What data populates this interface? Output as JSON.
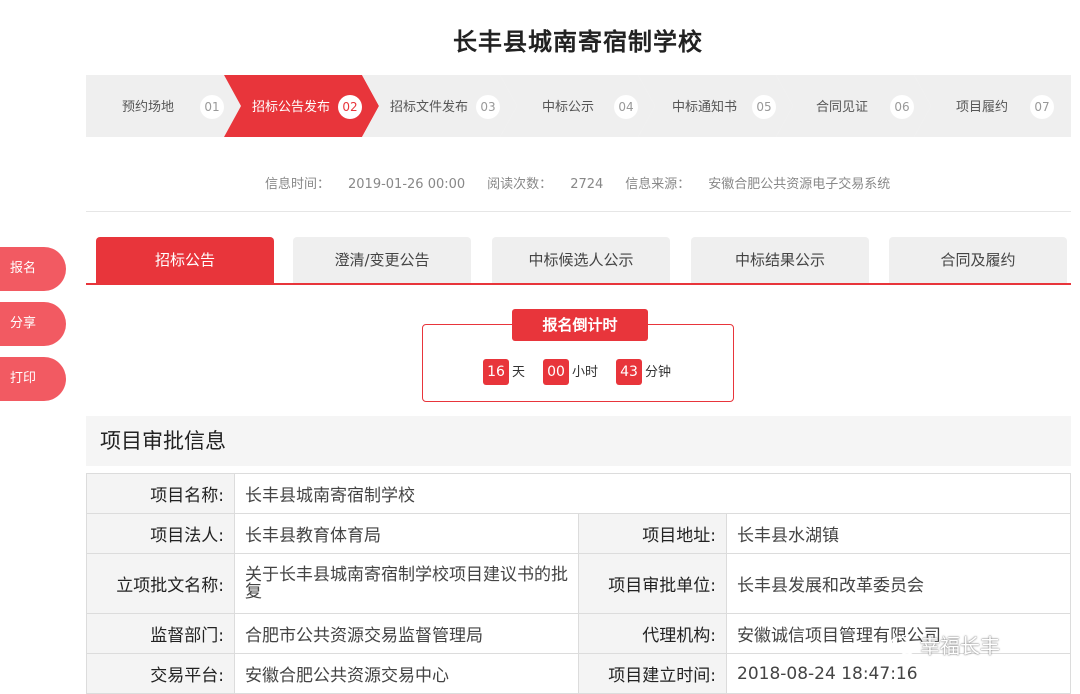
{
  "page_title": "长丰县城南寄宿制学校",
  "steps": [
    {
      "label": "预约场地",
      "num": "01"
    },
    {
      "label": "招标公告发布",
      "num": "02"
    },
    {
      "label": "招标文件发布",
      "num": "03"
    },
    {
      "label": "中标公示",
      "num": "04"
    },
    {
      "label": "中标通知书",
      "num": "05"
    },
    {
      "label": "合同见证",
      "num": "06"
    },
    {
      "label": "项目履约",
      "num": "07"
    }
  ],
  "info": {
    "time_label": "信息时间：",
    "time_value": "2019-01-26 00:00",
    "reads_label": "阅读次数：",
    "reads_value": "2724",
    "source_label": "信息来源：",
    "source_value": "安徽合肥公共资源电子交易系统"
  },
  "side_buttons": [
    "报名",
    "分享",
    "打印"
  ],
  "tabs": [
    "招标公告",
    "澄清/变更公告",
    "中标候选人公示",
    "中标结果公示",
    "合同及履约"
  ],
  "countdown": {
    "title": "报名倒计时",
    "days": "16",
    "days_unit": "天",
    "hours": "00",
    "hours_unit": "小时",
    "minutes": "43",
    "minutes_unit": "分钟"
  },
  "section_title": "项目审批信息",
  "table": {
    "name_label": "项目名称:",
    "name_value": "长丰县城南寄宿制学校",
    "legal_label": "项目法人:",
    "legal_value": "长丰县教育体育局",
    "addr_label": "项目地址:",
    "addr_value": "长丰县水湖镇",
    "doc_label": "立项批文名称:",
    "doc_value": "关于长丰县城南寄宿制学校项目建议书的批复",
    "approve_label": "项目审批单位:",
    "approve_value": "长丰县发展和改革委员会",
    "super_label": "监督部门:",
    "super_value": "合肥市公共资源交易监督管理局",
    "agent_label": "代理机构:",
    "agent_value": "安徽诚信项目管理有限公司",
    "platform_label": "交易平台:",
    "platform_value": "安徽合肥公共资源交易中心",
    "created_label": "项目建立时间:",
    "created_value": "2018-08-24 18:47:16"
  },
  "watermark": "幸福长丰",
  "colors": {
    "accent": "#e8353b",
    "side": "#f25a62",
    "step_bg": "#efefef"
  }
}
